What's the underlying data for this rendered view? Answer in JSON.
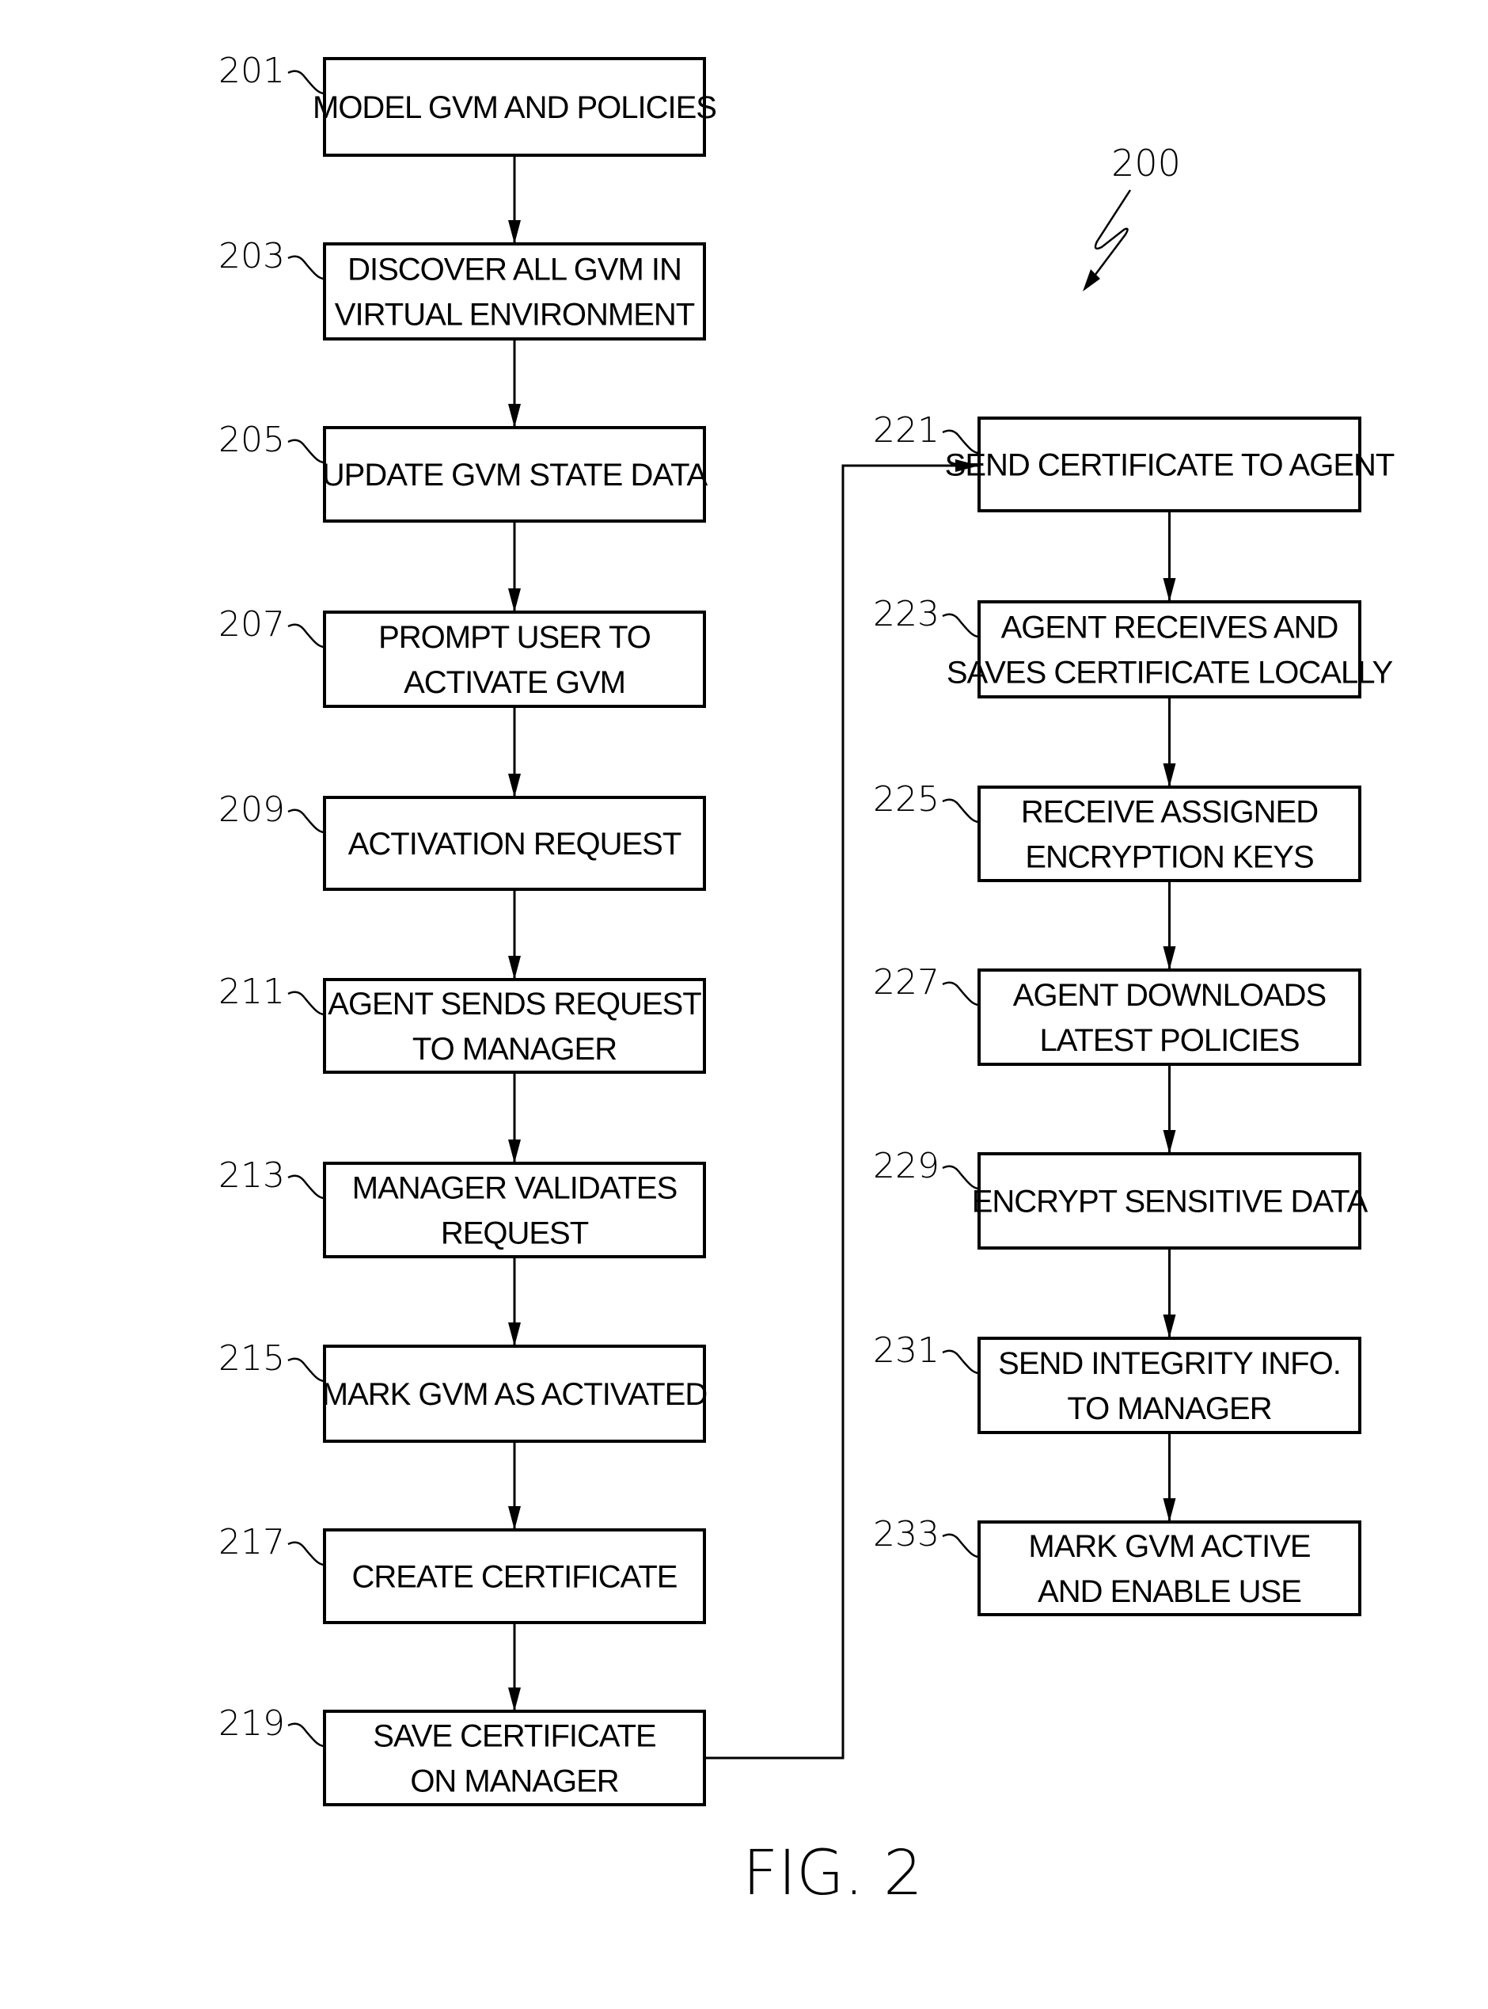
{
  "figure": {
    "caption": "FIG. 2",
    "reference_numeral": "200"
  },
  "steps": [
    {
      "id": "201",
      "lines": [
        "MODEL GVM AND POLICIES"
      ],
      "column": "left"
    },
    {
      "id": "203",
      "lines": [
        "DISCOVER ALL GVM IN",
        "VIRTUAL ENVIRONMENT"
      ],
      "column": "left"
    },
    {
      "id": "205",
      "lines": [
        "UPDATE GVM STATE DATA"
      ],
      "column": "left"
    },
    {
      "id": "207",
      "lines": [
        "PROMPT USER TO",
        "ACTIVATE GVM"
      ],
      "column": "left"
    },
    {
      "id": "209",
      "lines": [
        "ACTIVATION REQUEST"
      ],
      "column": "left"
    },
    {
      "id": "211",
      "lines": [
        "AGENT SENDS REQUEST",
        "TO MANAGER"
      ],
      "column": "left"
    },
    {
      "id": "213",
      "lines": [
        "MANAGER VALIDATES",
        "REQUEST"
      ],
      "column": "left"
    },
    {
      "id": "215",
      "lines": [
        "MARK GVM AS ACTIVATED"
      ],
      "column": "left"
    },
    {
      "id": "217",
      "lines": [
        "CREATE CERTIFICATE"
      ],
      "column": "left"
    },
    {
      "id": "219",
      "lines": [
        "SAVE CERTIFICATE",
        "ON MANAGER"
      ],
      "column": "left"
    },
    {
      "id": "221",
      "lines": [
        "SEND CERTIFICATE TO AGENT"
      ],
      "column": "right"
    },
    {
      "id": "223",
      "lines": [
        "AGENT RECEIVES AND",
        "SAVES CERTIFICATE LOCALLY"
      ],
      "column": "right"
    },
    {
      "id": "225",
      "lines": [
        "RECEIVE ASSIGNED",
        "ENCRYPTION KEYS"
      ],
      "column": "right"
    },
    {
      "id": "227",
      "lines": [
        "AGENT DOWNLOADS",
        "LATEST POLICIES"
      ],
      "column": "right"
    },
    {
      "id": "229",
      "lines": [
        "ENCRYPT SENSITIVE DATA"
      ],
      "column": "right"
    },
    {
      "id": "231",
      "lines": [
        "SEND INTEGRITY INFO.",
        "TO MANAGER"
      ],
      "column": "right"
    },
    {
      "id": "233",
      "lines": [
        "MARK GVM ACTIVE",
        "AND ENABLE USE"
      ],
      "column": "right"
    }
  ],
  "edges": [
    [
      "201",
      "203"
    ],
    [
      "203",
      "205"
    ],
    [
      "205",
      "207"
    ],
    [
      "207",
      "209"
    ],
    [
      "209",
      "211"
    ],
    [
      "211",
      "213"
    ],
    [
      "213",
      "215"
    ],
    [
      "215",
      "217"
    ],
    [
      "217",
      "219"
    ],
    [
      "219",
      "221"
    ],
    [
      "221",
      "223"
    ],
    [
      "223",
      "225"
    ],
    [
      "225",
      "227"
    ],
    [
      "227",
      "229"
    ],
    [
      "229",
      "231"
    ],
    [
      "231",
      "233"
    ]
  ]
}
